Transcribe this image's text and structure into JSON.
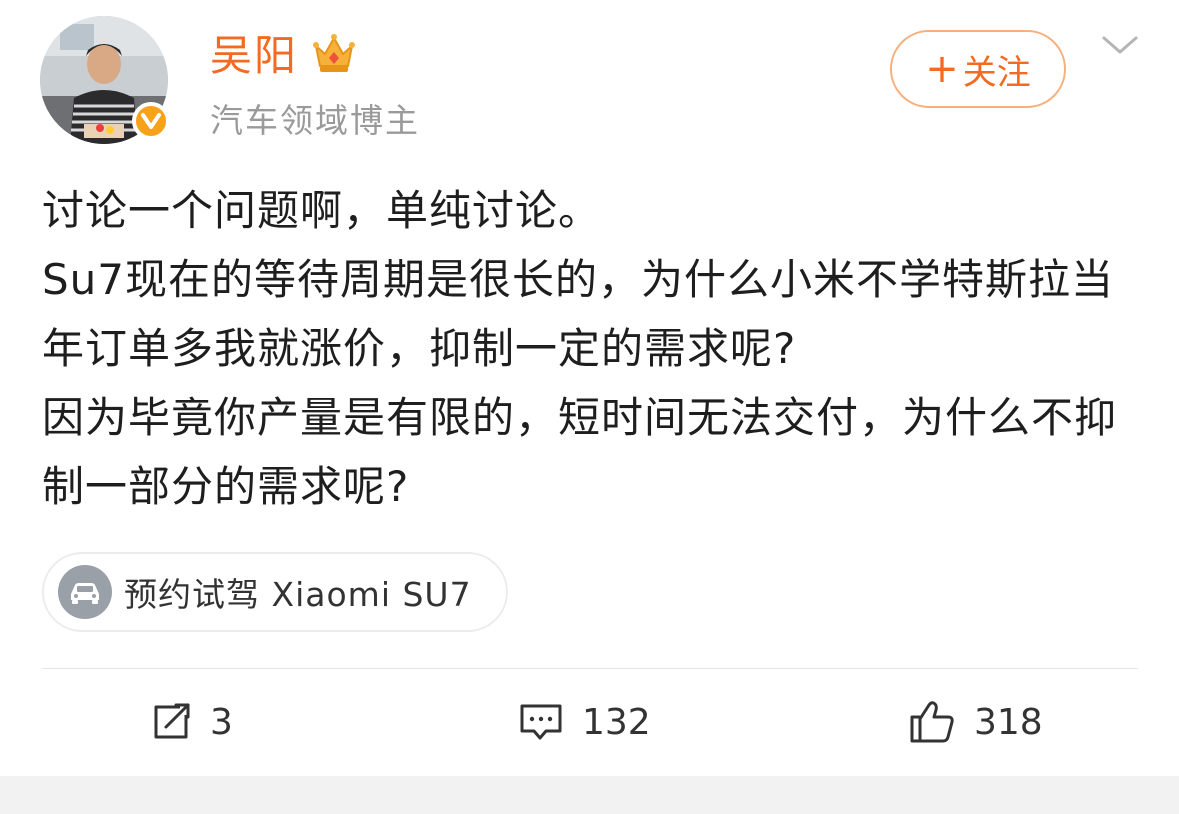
{
  "user": {
    "name": "吴阳",
    "description": "汽车领域博主"
  },
  "header": {
    "follow_label": "关注",
    "follow_plus": "+"
  },
  "post": {
    "lines": [
      "讨论一个问题啊，单纯讨论。",
      "Su7现在的等待周期是很长的，为什么小米不学特斯拉当年订单多我就涨价，抑制一定的需求呢?",
      "因为毕竟你产量是有限的，短时间无法交付，为什么不抑制一部分的需求呢?"
    ]
  },
  "tag": {
    "label": "预约试驾 Xiaomi SU7"
  },
  "actions": {
    "share_count": "3",
    "comment_count": "132",
    "like_count": "318"
  },
  "colors": {
    "username": "#f26b21",
    "follow_border": "#f6b07d",
    "verified_badge": "#f7a21b",
    "secondary_text": "#9a9a9a"
  },
  "icons": {
    "verified": "verified-v-icon",
    "crown": "crown-icon",
    "chevron": "chevron-down-icon",
    "car": "car-icon",
    "share": "share-icon",
    "comment": "comment-icon",
    "like": "thumbs-up-icon"
  }
}
